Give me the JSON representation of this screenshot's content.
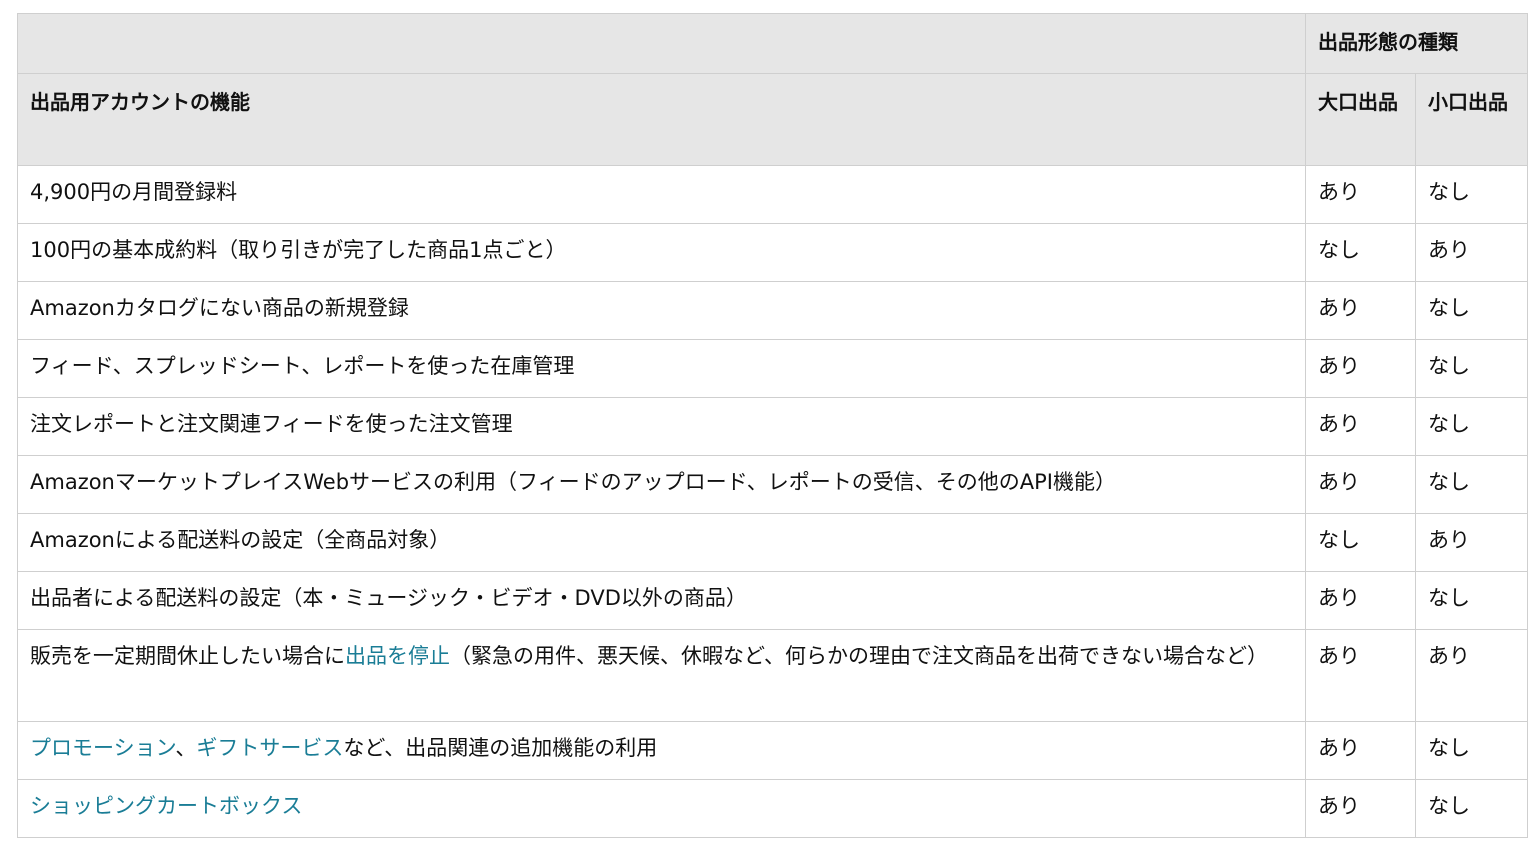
{
  "table": {
    "header": {
      "group_label": "出品形態の種類",
      "feature_label": "出品用アカウントの機能",
      "col_large": "大口出品",
      "col_small": "小口出品"
    },
    "rows": [
      {
        "parts": [
          {
            "text": "4,900円の月間登録料",
            "link": false
          }
        ],
        "large": "あり",
        "small": "なし"
      },
      {
        "parts": [
          {
            "text": "100円の基本成約料（取り引きが完了した商品1点ごと）",
            "link": false
          }
        ],
        "large": "なし",
        "small": "あり"
      },
      {
        "parts": [
          {
            "text": "Amazonカタログにない商品の新規登録",
            "link": false
          }
        ],
        "large": "あり",
        "small": "なし"
      },
      {
        "parts": [
          {
            "text": "フィード、スプレッドシート、レポートを使った在庫管理",
            "link": false
          }
        ],
        "large": "あり",
        "small": "なし"
      },
      {
        "parts": [
          {
            "text": "注文レポートと注文関連フィードを使った注文管理",
            "link": false
          }
        ],
        "large": "あり",
        "small": "なし"
      },
      {
        "parts": [
          {
            "text": "AmazonマーケットプレイスWebサービスの利用（フィードのアップロード、レポートの受信、その他のAPI機能）",
            "link": false
          }
        ],
        "large": "あり",
        "small": "なし"
      },
      {
        "parts": [
          {
            "text": "Amazonによる配送料の設定（全商品対象）",
            "link": false
          }
        ],
        "large": "なし",
        "small": "あり"
      },
      {
        "parts": [
          {
            "text": "出品者による配送料の設定（本・ミュージック・ビデオ・DVD以外の商品）",
            "link": false
          }
        ],
        "large": "あり",
        "small": "なし"
      },
      {
        "tall": true,
        "parts": [
          {
            "text": "販売を一定期間休止したい場合に",
            "link": false
          },
          {
            "text": "出品を停止",
            "link": true
          },
          {
            "text": "（緊急の用件、悪天候、休暇など、何らかの理由で注文商品を出荷できない場合など）",
            "link": false
          }
        ],
        "large": "あり",
        "small": "あり"
      },
      {
        "parts": [
          {
            "text": "プロモーション",
            "link": true
          },
          {
            "text": "、",
            "link": false
          },
          {
            "text": "ギフトサービス",
            "link": true
          },
          {
            "text": "など、出品関連の追加機能の利用",
            "link": false
          }
        ],
        "large": "あり",
        "small": "なし"
      },
      {
        "parts": [
          {
            "text": "ショッピングカートボックス",
            "link": true
          }
        ],
        "large": "あり",
        "small": "なし"
      }
    ],
    "colors": {
      "header_bg": "#e6e6e6",
      "border": "#cfcfcf",
      "link": "#1a7d96"
    }
  }
}
